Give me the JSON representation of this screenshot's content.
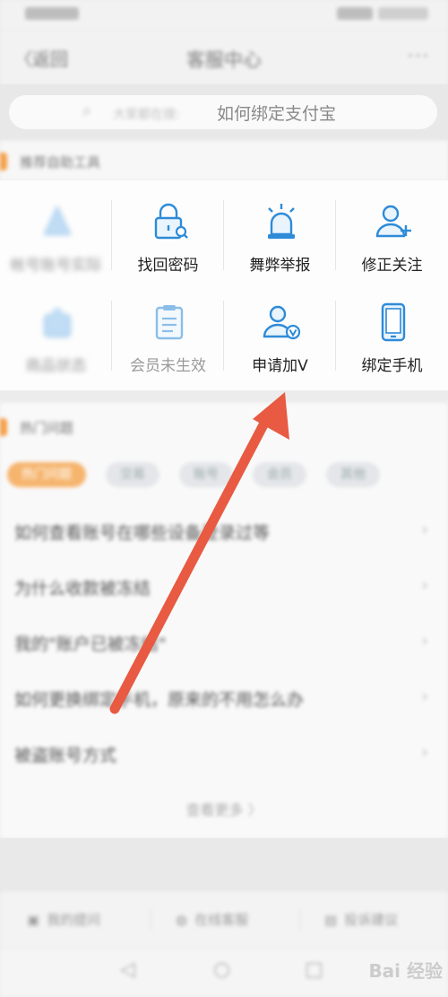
{
  "status_bar": {},
  "nav": {
    "back_label": "〈返回",
    "title": "客服中心",
    "more_label": "···"
  },
  "search": {
    "prefix": "大家都在搜:",
    "query": "如何绑定支付宝"
  },
  "tools_section": {
    "title": "推荐自助工具"
  },
  "tools": [
    {
      "label": "帐号账号实际",
      "icon": "account-icon",
      "faded": true
    },
    {
      "label": "找回密码",
      "icon": "lock-search-icon",
      "faded": false
    },
    {
      "label": "舞弊举报",
      "icon": "alarm-light-icon",
      "faded": false
    },
    {
      "label": "修正关注",
      "icon": "user-add-icon",
      "faded": false
    },
    {
      "label": "商品状态",
      "icon": "bag-icon",
      "faded": true
    },
    {
      "label": "会员未生效",
      "icon": "clipboard-icon",
      "faded": true
    },
    {
      "label": "申请加V",
      "icon": "user-verify-icon",
      "faded": false
    },
    {
      "label": "绑定手机",
      "icon": "phone-icon",
      "faded": false
    }
  ],
  "hot_section": {
    "title": "热门问题"
  },
  "tabs": [
    "热门问题",
    "交易",
    "账号",
    "会员",
    "其他"
  ],
  "questions": [
    "如何查看账号在哪些设备登录过等",
    "为什么收款被冻结",
    "我的\"账户已被冻结\"",
    "如何更换绑定手机，原来的不用怎么办",
    "被盗账号方式"
  ],
  "more_label": "查看更多 〉",
  "bottom_bar": [
    {
      "icon": "question-icon",
      "label": "我的提问"
    },
    {
      "icon": "chat-icon",
      "label": "在线客服"
    },
    {
      "icon": "doc-icon",
      "label": "投诉建议"
    }
  ],
  "watermark": "Bai 经验",
  "colors": {
    "accent_orange": "#f5a04a",
    "icon_blue": "#2e8bd8",
    "arrow_red": "#e85a42"
  }
}
